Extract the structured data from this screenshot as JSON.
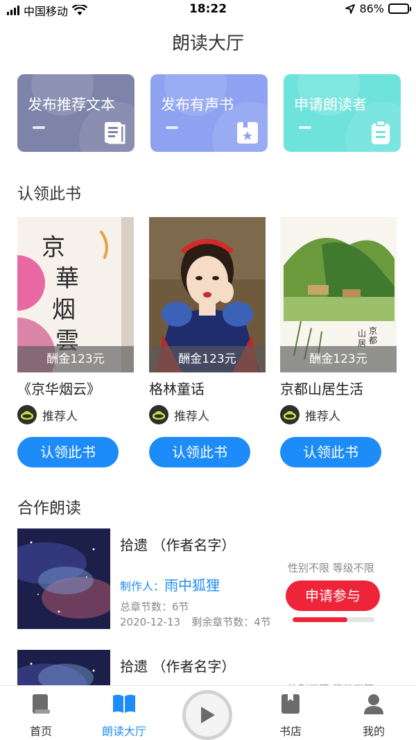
{
  "status_bar": {
    "carrier": "中国移动",
    "time": "18:22",
    "battery": "86%"
  },
  "page_title": "朗读大厅",
  "action_cards": [
    {
      "label": "发布推荐文本",
      "color": "#7d83a9",
      "icon": "document-icon"
    },
    {
      "label": "发布有声书",
      "color": "#8ea2f1",
      "icon": "star-bookmark-icon"
    },
    {
      "label": "申请朗读者",
      "color": "#6ee3dc",
      "icon": "clipboard-icon"
    }
  ],
  "claim_section": {
    "title": "认领此书",
    "books": [
      {
        "reward": "酬金123元",
        "name": "《京华烟云》",
        "recommender": "推荐人",
        "button": "认领此书"
      },
      {
        "reward": "酬金123元",
        "name": "格林童话",
        "recommender": "推荐人",
        "button": "认领此书"
      },
      {
        "reward": "酬金123元",
        "name": "京都山居生活",
        "recommender": "推荐人",
        "button": "认领此书"
      }
    ]
  },
  "coop_section": {
    "title": "合作朗读",
    "items": [
      {
        "title": "拾遗 （作者名字）",
        "limits": "性别不限 等级不限",
        "producer_label": "制作人：",
        "producer_name": "雨中狐狸",
        "total_chapters": "总章节数：6节",
        "date": "2020-12-13",
        "remaining": "剩余章节数：4节",
        "button": "申请参与",
        "progress": 0.67
      },
      {
        "title": "拾遗 （作者名字）",
        "limits": "性别不限 等级不限"
      }
    ]
  },
  "tab_bar": {
    "tabs": [
      {
        "label": "首页",
        "icon": "home-book-icon"
      },
      {
        "label": "朗读大厅",
        "icon": "open-book-icon",
        "active": true
      },
      {
        "label": "书店",
        "icon": "bookstore-icon"
      },
      {
        "label": "我的",
        "icon": "profile-icon"
      }
    ],
    "play_icon": "play-icon",
    "active_color": "#1d8cf8"
  }
}
